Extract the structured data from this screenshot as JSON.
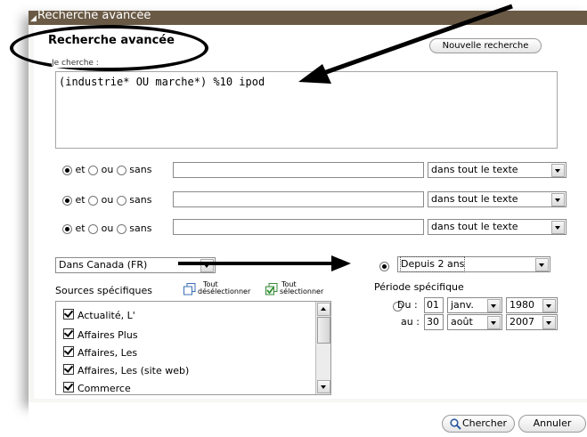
{
  "window": {
    "title": "Recherche avancée"
  },
  "form": {
    "heading": "Recherche avancée",
    "new_search_label": "Nouvelle recherche",
    "subhead": "Je cherche :",
    "query_value": "(industrie* OU marche*) %10 ipod"
  },
  "clauses": [
    {
      "opt_and": "et",
      "opt_or": "ou",
      "opt_not": "sans",
      "value": "",
      "scope": "dans tout le texte"
    },
    {
      "opt_and": "et",
      "opt_or": "ou",
      "opt_not": "sans",
      "value": "",
      "scope": "dans tout le texte"
    },
    {
      "opt_and": "et",
      "opt_or": "ou",
      "opt_not": "sans",
      "value": "",
      "scope": "dans tout le texte"
    }
  ],
  "sources": {
    "region": "Dans Canada (FR)",
    "label": "Sources spécifiques",
    "deselect_all": [
      "Tout",
      "désélectionner"
    ],
    "select_all": [
      "Tout",
      "sélectionner"
    ],
    "items": [
      "Actualité, L'",
      "Affaires Plus",
      "Affaires, Les",
      "Affaires, Les (site web)",
      "Commerce"
    ]
  },
  "period": {
    "preset": "Depuis 2 ans",
    "specific_label": "Période spécifique",
    "from_label": "Du :",
    "from_day": "01",
    "from_month": "janv.",
    "from_year": "1980",
    "to_label": "au :",
    "to_day": "30",
    "to_month": "août",
    "to_year": "2007"
  },
  "actions": {
    "search_label": "Chercher",
    "cancel_label": "Annuler"
  }
}
